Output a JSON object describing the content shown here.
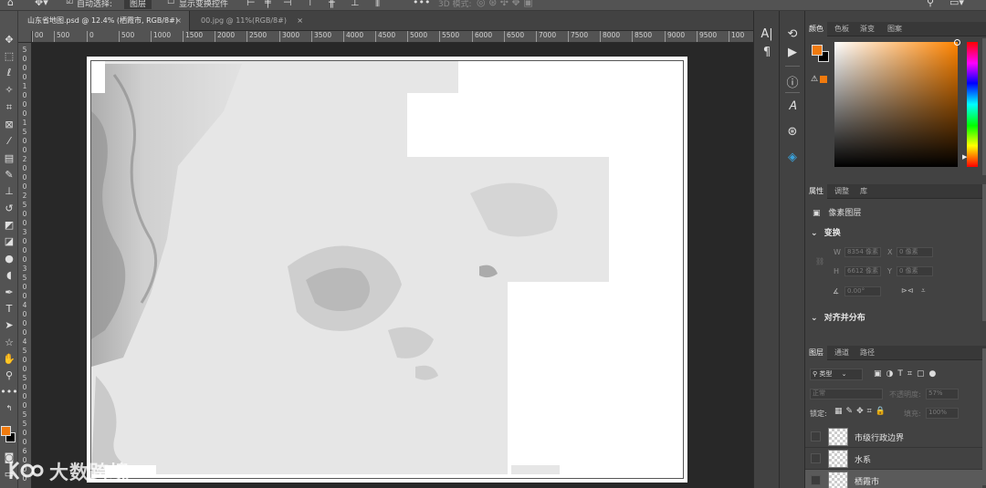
{
  "options_bar": {
    "auto_select_label": "自动选择:",
    "auto_select_value": "图层",
    "transform_controls_label": "显示变换控件",
    "mode_3d_label": "3D 模式:"
  },
  "tabs": [
    {
      "label": "山东省地图.psd @ 12.4% (栖霞市, RGB/8#)",
      "close": "×"
    },
    {
      "label": "00.jpg @ 11%(RGB/8#)",
      "close": "×"
    }
  ],
  "ruler_h": [
    "00",
    "500",
    "0",
    "500",
    "1000",
    "1500",
    "2000",
    "2500",
    "3000",
    "3500",
    "4000",
    "4500",
    "5000",
    "5500",
    "6000",
    "6500",
    "7000",
    "7500",
    "8000",
    "8500",
    "9000",
    "9500",
    "100"
  ],
  "ruler_v": [
    "5",
    "0",
    "0",
    "0",
    "1",
    "0",
    "0",
    "0",
    "1",
    "5",
    "0",
    "0",
    "2",
    "0",
    "0",
    "0",
    "2",
    "5",
    "0",
    "0",
    "3",
    "0",
    "0",
    "0",
    "3",
    "5",
    "0",
    "0",
    "4",
    "0",
    "0",
    "0",
    "4",
    "5",
    "0",
    "0",
    "5",
    "0",
    "0",
    "0",
    "5",
    "5",
    "0",
    "0",
    "6",
    "0",
    "0",
    "0"
  ],
  "watermark": {
    "text": "大数跨境"
  },
  "colors": {
    "foreground": "#f07a0e",
    "background": "#000000",
    "accent": "#ff8400",
    "canvas_bg": "#282828",
    "panel_bg": "#424242"
  },
  "color_panel": {
    "tabs": [
      "颜色",
      "色板",
      "渐变",
      "图案"
    ]
  },
  "properties_panel": {
    "tabs": [
      "属性",
      "调整",
      "库"
    ],
    "layer_type": "像素图层",
    "transform_title": "变换",
    "w_label": "W",
    "w_value": "8354 像素",
    "h_label": "H",
    "h_value": "6612 像素",
    "x_label": "X",
    "x_value": "0 像素",
    "y_label": "Y",
    "y_value": "0 像素",
    "angle_value": "0.00°",
    "align_title": "对齐并分布"
  },
  "layers_panel": {
    "tabs": [
      "图层",
      "通道",
      "路径"
    ],
    "filter_kind": "类型",
    "blend_mode": "正常",
    "opacity_label": "不透明度:",
    "opacity_value": "57%",
    "lock_label": "锁定:",
    "fill_label": "填充:",
    "fill_value": "100%",
    "layers": [
      {
        "name": "市级行政边界"
      },
      {
        "name": "水系"
      },
      {
        "name": "栖霞市"
      }
    ]
  }
}
